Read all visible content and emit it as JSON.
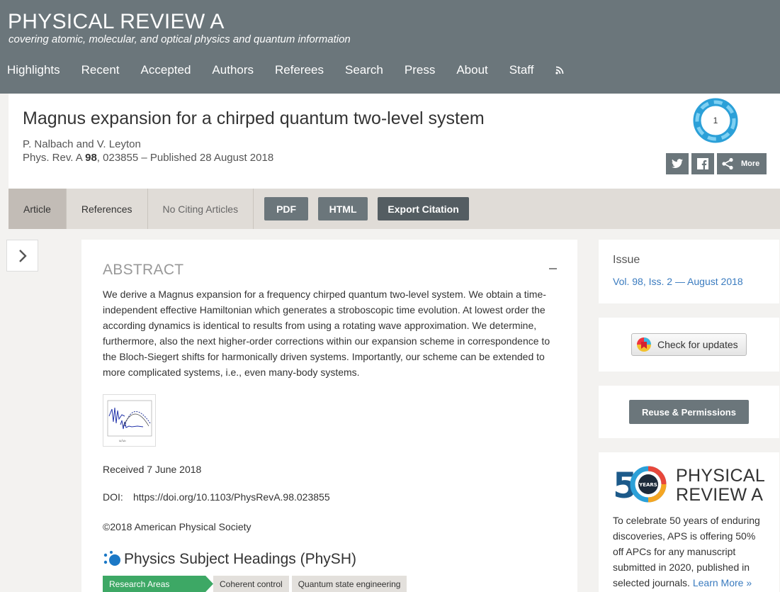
{
  "header": {
    "title": "PHYSICAL REVIEW A",
    "subtitle": "covering atomic, molecular, and optical physics and quantum information",
    "nav": [
      "Highlights",
      "Recent",
      "Accepted",
      "Authors",
      "Referees",
      "Search",
      "Press",
      "About",
      "Staff"
    ],
    "rss_icon": "rss-icon"
  },
  "article": {
    "title": "Magnus expansion for a chirped quantum two-level system",
    "authors": "P. Nalbach and V. Leyton",
    "journal": "Phys. Rev. A ",
    "volume": "98",
    "citation_rest": ", 023855 – Published 28 August 2018",
    "altmetric_count": "1",
    "share_more": "More"
  },
  "tabs": {
    "article": "Article",
    "references": "References",
    "citing": "No Citing Articles",
    "pdf": "PDF",
    "html": "HTML",
    "export": "Export Citation"
  },
  "abstract": {
    "heading": "ABSTRACT",
    "text": "We derive a Magnus expansion for a frequency chirped quantum two-level system. We obtain a time-independent effective Hamiltonian which generates a stroboscopic time evolution. At lowest order the according dynamics is identical to results from using a rotating wave approximation. We determine, furthermore, also the next higher-order corrections within our expansion scheme in correspondence to the Bloch-Siegert shifts for harmonically driven systems. Importantly, our scheme can be extended to more complicated systems, i.e., even many-body systems.",
    "received": "Received 7 June 2018",
    "doi_label": "DOI:",
    "doi": "https://doi.org/10.1103/PhysRevA.98.023855",
    "copyright": "©2018 American Physical Society"
  },
  "physh": {
    "heading": "Physics Subject Headings (PhySH)",
    "category": "Research Areas",
    "tags": [
      "Coherent control",
      "Quantum state engineering"
    ]
  },
  "sidebar": {
    "issue_label": "Issue",
    "issue_link": "Vol. 98, Iss. 2 — August 2018",
    "updates": "Check for updates",
    "reuse": "Reuse & Permissions",
    "anniv_line1": "PHYSICAL",
    "anniv_line2": "REVIEW A",
    "anniv_years": "YEARS",
    "anniv_text": "To celebrate 50 years of enduring discoveries, APS is offering 50% off APCs for any manuscript submitted in 2020, published in selected journals. ",
    "learn_more": "Learn More »"
  },
  "colors": {
    "header_bg": "#6b767b",
    "tab_bar_bg": "#e0dcd7",
    "link_blue": "#3a7bbf",
    "research_green": "#3da865"
  }
}
